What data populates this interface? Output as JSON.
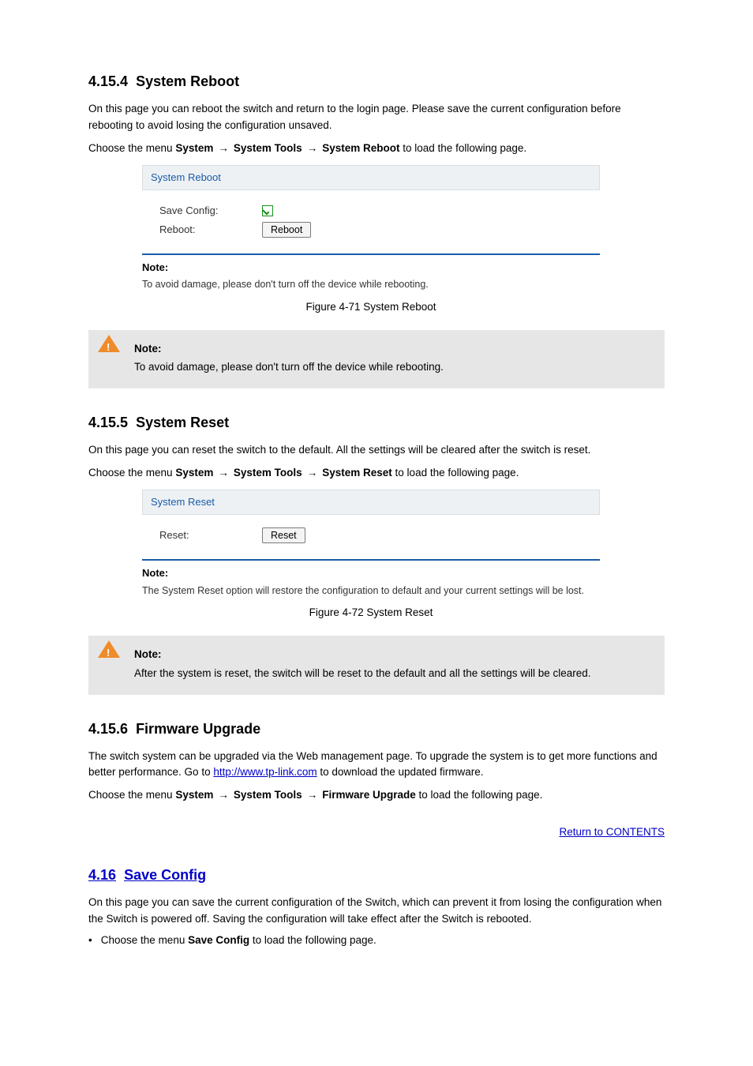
{
  "sections": {
    "reboot": {
      "heading_no": "4.15.4",
      "heading_txt": "System Reboot",
      "intro": "On this page you can reboot the switch and return to the login page. Please save the current configuration before rebooting to avoid losing the configuration unsaved.",
      "crumb_label": "Choose the menu",
      "crumb_1": "System",
      "crumb_2": "System Tools",
      "crumb_3": "System Reboot",
      "crumb_tail": "to load the following page.",
      "panel_title": "System Reboot",
      "row1_label": "Save Config:",
      "row2_label": "Reboot:",
      "btn": "Reboot",
      "note_title": "Note:",
      "note_text": "To avoid damage, please don't turn off the device while rebooting.",
      "fig_caption": "Figure 4-71 System Reboot",
      "callout_title": "Note:",
      "callout_text": "To avoid damage, please don't turn off the device while rebooting."
    },
    "reset": {
      "heading_no": "4.15.5",
      "heading_txt": "System Reset",
      "intro": "On this page you can reset the switch to the default. All the settings will be cleared after the switch is reset.",
      "crumb_label": "Choose the menu",
      "crumb_1": "System",
      "crumb_2": "System Tools",
      "crumb_3": "System Reset",
      "crumb_tail": "to load the following page.",
      "panel_title": "System Reset",
      "row_label": "Reset:",
      "btn": "Reset",
      "note_title": "Note:",
      "note_text": "The System Reset option will restore the configuration to default and your current settings will be lost.",
      "fig_caption": "Figure 4-72 System Reset",
      "callout_title": "Note:",
      "callout_text": "After the system is reset, the switch will be reset to the default and all the settings will be cleared."
    },
    "firmware": {
      "heading_no": "4.15.6",
      "heading_txt": "Firmware Upgrade",
      "p1_a": "The switch system can be upgraded via the Web management page. To upgrade the system is to get more functions and better performance. Go to ",
      "p1_link": "http://www.tp-link.com",
      "p1_b": " to download the updated firmware.",
      "crumb_label": "Choose the menu",
      "crumb_1": "System",
      "crumb_2": "System Tools",
      "crumb_3": "Firmware Upgrade",
      "crumb_tail": "to load the following page."
    },
    "save": {
      "heading_no": "4.16",
      "heading_txt": "Save Config",
      "p1": "On this page you can save the current configuration of the Switch, which can prevent it from losing the configuration when the Switch is powered off. Saving the configuration will take effect after the Switch is rebooted.",
      "p2_a": "Choose the menu ",
      "p2_b": "Save Config",
      "p2_c": " to load the following page.",
      "back_link": "Return to CONTENTS"
    }
  },
  "glyphs": {
    "arrow": "→",
    "bullet": "•"
  }
}
